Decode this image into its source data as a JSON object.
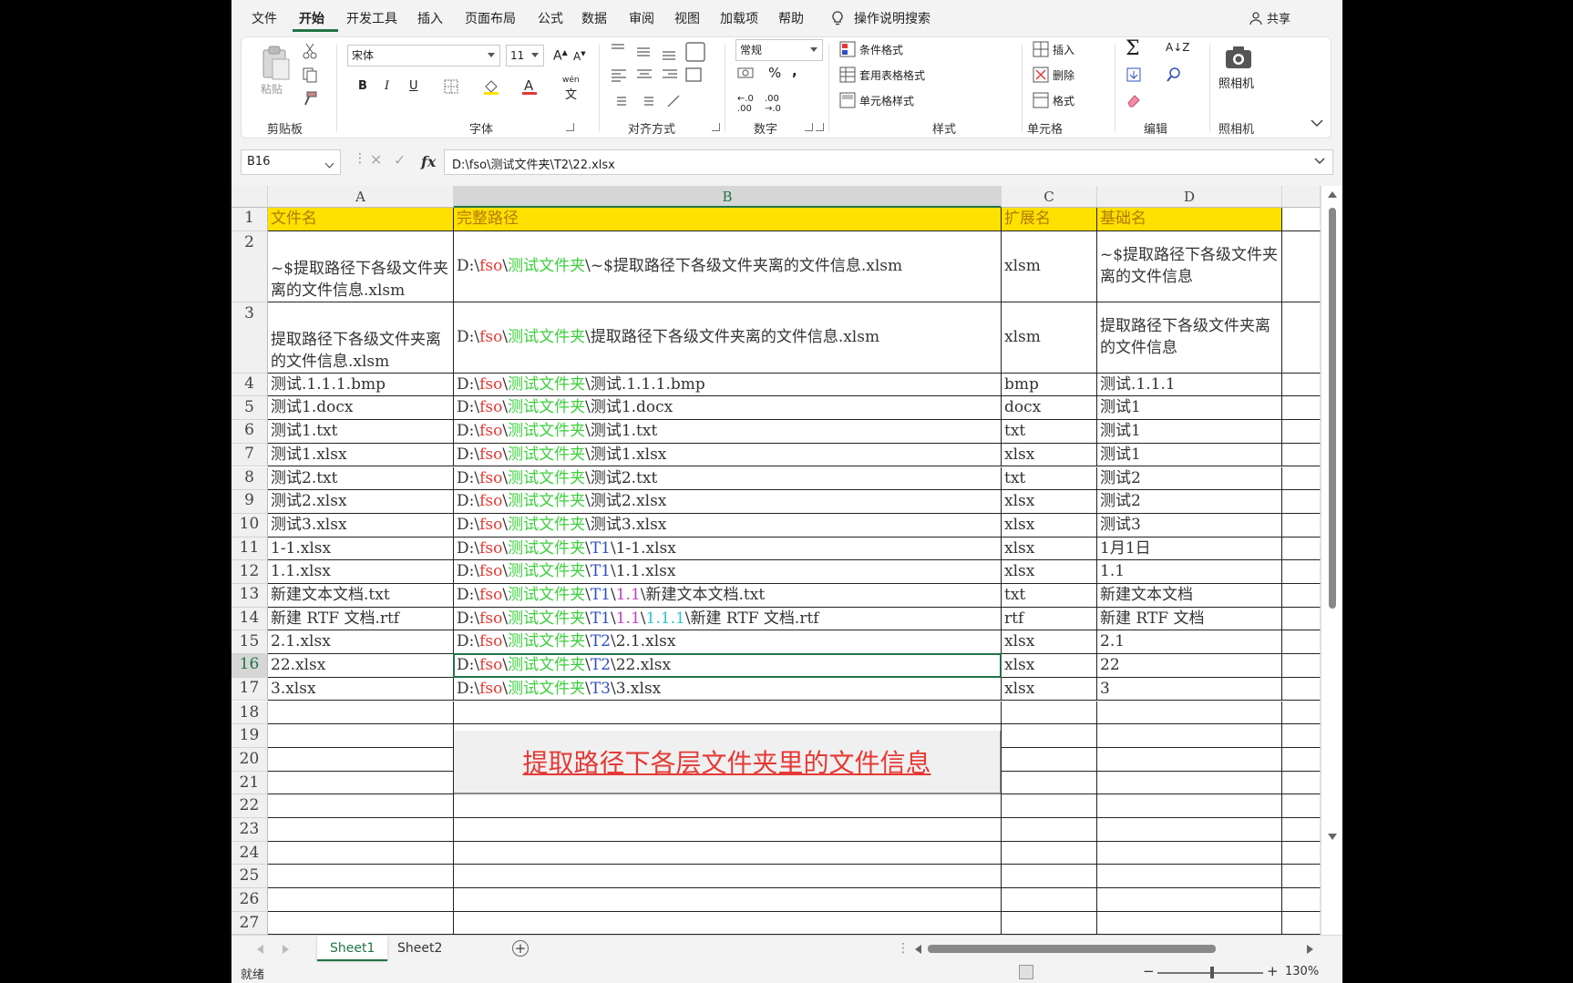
{
  "menu": {
    "items": [
      "文件",
      "开始",
      "开发工具",
      "插入",
      "页面布局",
      "公式",
      "数据",
      "审阅",
      "视图",
      "加载项",
      "帮助"
    ],
    "active_index": 1,
    "search_label": "操作说明搜索",
    "share_label": "共享"
  },
  "ribbon": {
    "clipboard": {
      "paste_label": "粘贴",
      "group_label": "剪贴板"
    },
    "font": {
      "font_name": "宋体",
      "font_size": "11",
      "bold": "B",
      "italic": "I",
      "underline": "U",
      "group_label": "字体",
      "phonetic": "wén"
    },
    "alignment": {
      "group_label": "对齐方式"
    },
    "number": {
      "format": "常规",
      "percent": "%",
      "comma": ",",
      "group_label": "数字"
    },
    "styles": {
      "conditional": "条件格式",
      "table_format": "套用表格格式",
      "cell_styles": "单元格样式",
      "group_label": "样式"
    },
    "cells": {
      "insert": "插入",
      "delete": "删除",
      "format": "格式",
      "group_label": "单元格"
    },
    "editing": {
      "group_label": "编辑"
    },
    "camera": {
      "label": "照相机",
      "group_label": "照相机"
    }
  },
  "formula_bar": {
    "name_box": "B16",
    "formula": "D:\\fso\\测试文件夹\\T2\\22.xlsx"
  },
  "columns": [
    "A",
    "B",
    "C",
    "D"
  ],
  "selected_column": "B",
  "selected_row": "16",
  "rows": [
    {
      "n": "1",
      "a": "文件名",
      "b": [
        [
          "完整路径",
          ""
        ]
      ],
      "c": "扩展名",
      "d": "基础名"
    },
    {
      "n": "2",
      "a": "~$提取路径下各级文件夹离的文件信息.xlsm",
      "b": [
        [
          "D:\\",
          ""
        ],
        [
          "fso",
          "red"
        ],
        [
          "\\",
          ""
        ],
        [
          "测试文件夹",
          "green"
        ],
        [
          "\\~$提取路径下各级文件夹离的文件信息.xlsm",
          ""
        ]
      ],
      "c": "xlsm",
      "d": "~$提取路径下各级文件夹离的文件信息"
    },
    {
      "n": "3",
      "a": "提取路径下各级文件夹离的文件信息.xlsm",
      "b": [
        [
          "D:\\",
          ""
        ],
        [
          "fso",
          "red"
        ],
        [
          "\\",
          ""
        ],
        [
          "测试文件夹",
          "green"
        ],
        [
          "\\提取路径下各级文件夹离的文件信息.xlsm",
          ""
        ]
      ],
      "c": "xlsm",
      "d": "提取路径下各级文件夹离的文件信息"
    },
    {
      "n": "4",
      "a": "测试.1.1.1.bmp",
      "b": [
        [
          "D:\\",
          ""
        ],
        [
          "fso",
          "red"
        ],
        [
          "\\",
          ""
        ],
        [
          "测试文件夹",
          "green"
        ],
        [
          "\\测试.1.1.1.bmp",
          ""
        ]
      ],
      "c": "bmp",
      "d": "测试.1.1.1"
    },
    {
      "n": "5",
      "a": "测试1.docx",
      "b": [
        [
          "D:\\",
          ""
        ],
        [
          "fso",
          "red"
        ],
        [
          "\\",
          ""
        ],
        [
          "测试文件夹",
          "green"
        ],
        [
          "\\测试1.docx",
          ""
        ]
      ],
      "c": "docx",
      "d": "测试1"
    },
    {
      "n": "6",
      "a": "测试1.txt",
      "b": [
        [
          "D:\\",
          ""
        ],
        [
          "fso",
          "red"
        ],
        [
          "\\",
          ""
        ],
        [
          "测试文件夹",
          "green"
        ],
        [
          "\\测试1.txt",
          ""
        ]
      ],
      "c": "txt",
      "d": "测试1"
    },
    {
      "n": "7",
      "a": "测试1.xlsx",
      "b": [
        [
          "D:\\",
          ""
        ],
        [
          "fso",
          "red"
        ],
        [
          "\\",
          ""
        ],
        [
          "测试文件夹",
          "green"
        ],
        [
          "\\测试1.xlsx",
          ""
        ]
      ],
      "c": "xlsx",
      "d": "测试1"
    },
    {
      "n": "8",
      "a": "测试2.txt",
      "b": [
        [
          "D:\\",
          ""
        ],
        [
          "fso",
          "red"
        ],
        [
          "\\",
          ""
        ],
        [
          "测试文件夹",
          "green"
        ],
        [
          "\\测试2.txt",
          ""
        ]
      ],
      "c": "txt",
      "d": "测试2"
    },
    {
      "n": "9",
      "a": "测试2.xlsx",
      "b": [
        [
          "D:\\",
          ""
        ],
        [
          "fso",
          "red"
        ],
        [
          "\\",
          ""
        ],
        [
          "测试文件夹",
          "green"
        ],
        [
          "\\测试2.xlsx",
          ""
        ]
      ],
      "c": "xlsx",
      "d": "测试2"
    },
    {
      "n": "10",
      "a": "测试3.xlsx",
      "b": [
        [
          "D:\\",
          ""
        ],
        [
          "fso",
          "red"
        ],
        [
          "\\",
          ""
        ],
        [
          "测试文件夹",
          "green"
        ],
        [
          "\\测试3.xlsx",
          ""
        ]
      ],
      "c": "xlsx",
      "d": "测试3"
    },
    {
      "n": "11",
      "a": "1-1.xlsx",
      "b": [
        [
          "D:\\",
          ""
        ],
        [
          "fso",
          "red"
        ],
        [
          "\\",
          ""
        ],
        [
          "测试文件夹",
          "green"
        ],
        [
          "\\",
          ""
        ],
        [
          "T1",
          "blue"
        ],
        [
          "\\1-1.xlsx",
          ""
        ]
      ],
      "c": "xlsx",
      "d": "1月1日"
    },
    {
      "n": "12",
      "a": "1.1.xlsx",
      "b": [
        [
          "D:\\",
          ""
        ],
        [
          "fso",
          "red"
        ],
        [
          "\\",
          ""
        ],
        [
          "测试文件夹",
          "green"
        ],
        [
          "\\",
          ""
        ],
        [
          "T1",
          "blue"
        ],
        [
          "\\1.1.xlsx",
          ""
        ]
      ],
      "c": "xlsx",
      "d": "1.1"
    },
    {
      "n": "13",
      "a": "新建文本文档.txt",
      "b": [
        [
          "D:\\",
          ""
        ],
        [
          "fso",
          "red"
        ],
        [
          "\\",
          ""
        ],
        [
          "测试文件夹",
          "green"
        ],
        [
          "\\",
          ""
        ],
        [
          "T1",
          "blue"
        ],
        [
          "\\",
          ""
        ],
        [
          "1.1",
          "magenta"
        ],
        [
          "\\新建文本文档.txt",
          ""
        ]
      ],
      "c": "txt",
      "d": "新建文本文档"
    },
    {
      "n": "14",
      "a": "新建 RTF 文档.rtf",
      "b": [
        [
          "D:\\",
          ""
        ],
        [
          "fso",
          "red"
        ],
        [
          "\\",
          ""
        ],
        [
          "测试文件夹",
          "green"
        ],
        [
          "\\",
          ""
        ],
        [
          "T1",
          "blue"
        ],
        [
          "\\",
          ""
        ],
        [
          "1.1",
          "magenta"
        ],
        [
          "\\",
          ""
        ],
        [
          "1.1.1",
          "teal"
        ],
        [
          "\\新建 RTF 文档.rtf",
          ""
        ]
      ],
      "c": "rtf",
      "d": "新建 RTF 文档"
    },
    {
      "n": "15",
      "a": "2.1.xlsx",
      "b": [
        [
          "D:\\",
          ""
        ],
        [
          "fso",
          "red"
        ],
        [
          "\\",
          ""
        ],
        [
          "测试文件夹",
          "green"
        ],
        [
          "\\",
          ""
        ],
        [
          "T2",
          "blue"
        ],
        [
          "\\2.1.xlsx",
          ""
        ]
      ],
      "c": "xlsx",
      "d": "2.1"
    },
    {
      "n": "16",
      "a": "22.xlsx",
      "b": [
        [
          "D:\\",
          ""
        ],
        [
          "fso",
          "red"
        ],
        [
          "\\",
          ""
        ],
        [
          "测试文件夹",
          "green"
        ],
        [
          "\\",
          ""
        ],
        [
          "T2",
          "blue"
        ],
        [
          "\\22.xlsx",
          ""
        ]
      ],
      "c": "xlsx",
      "d": "22"
    },
    {
      "n": "17",
      "a": "3.xlsx",
      "b": [
        [
          "D:\\",
          ""
        ],
        [
          "fso",
          "red"
        ],
        [
          "\\",
          ""
        ],
        [
          "测试文件夹",
          "green"
        ],
        [
          "\\",
          ""
        ],
        [
          "T3",
          "blue"
        ],
        [
          "\\3.xlsx",
          ""
        ]
      ],
      "c": "xlsx",
      "d": "3"
    }
  ],
  "empty_rows": [
    "18",
    "19",
    "20",
    "21",
    "22",
    "23",
    "24",
    "25",
    "26",
    "27"
  ],
  "macro_button": {
    "label": "提取路径下各层文件夹里的文件信息"
  },
  "sheets": [
    {
      "name": "Sheet1",
      "active": true
    },
    {
      "name": "Sheet2",
      "active": false
    }
  ],
  "status": {
    "text": "就绪",
    "zoom": "130%"
  },
  "colors": {
    "accent": "#217346",
    "header_fill": "#ffe100",
    "red": "#e53935",
    "green": "#3ccf3c",
    "blue": "#3050c0"
  }
}
